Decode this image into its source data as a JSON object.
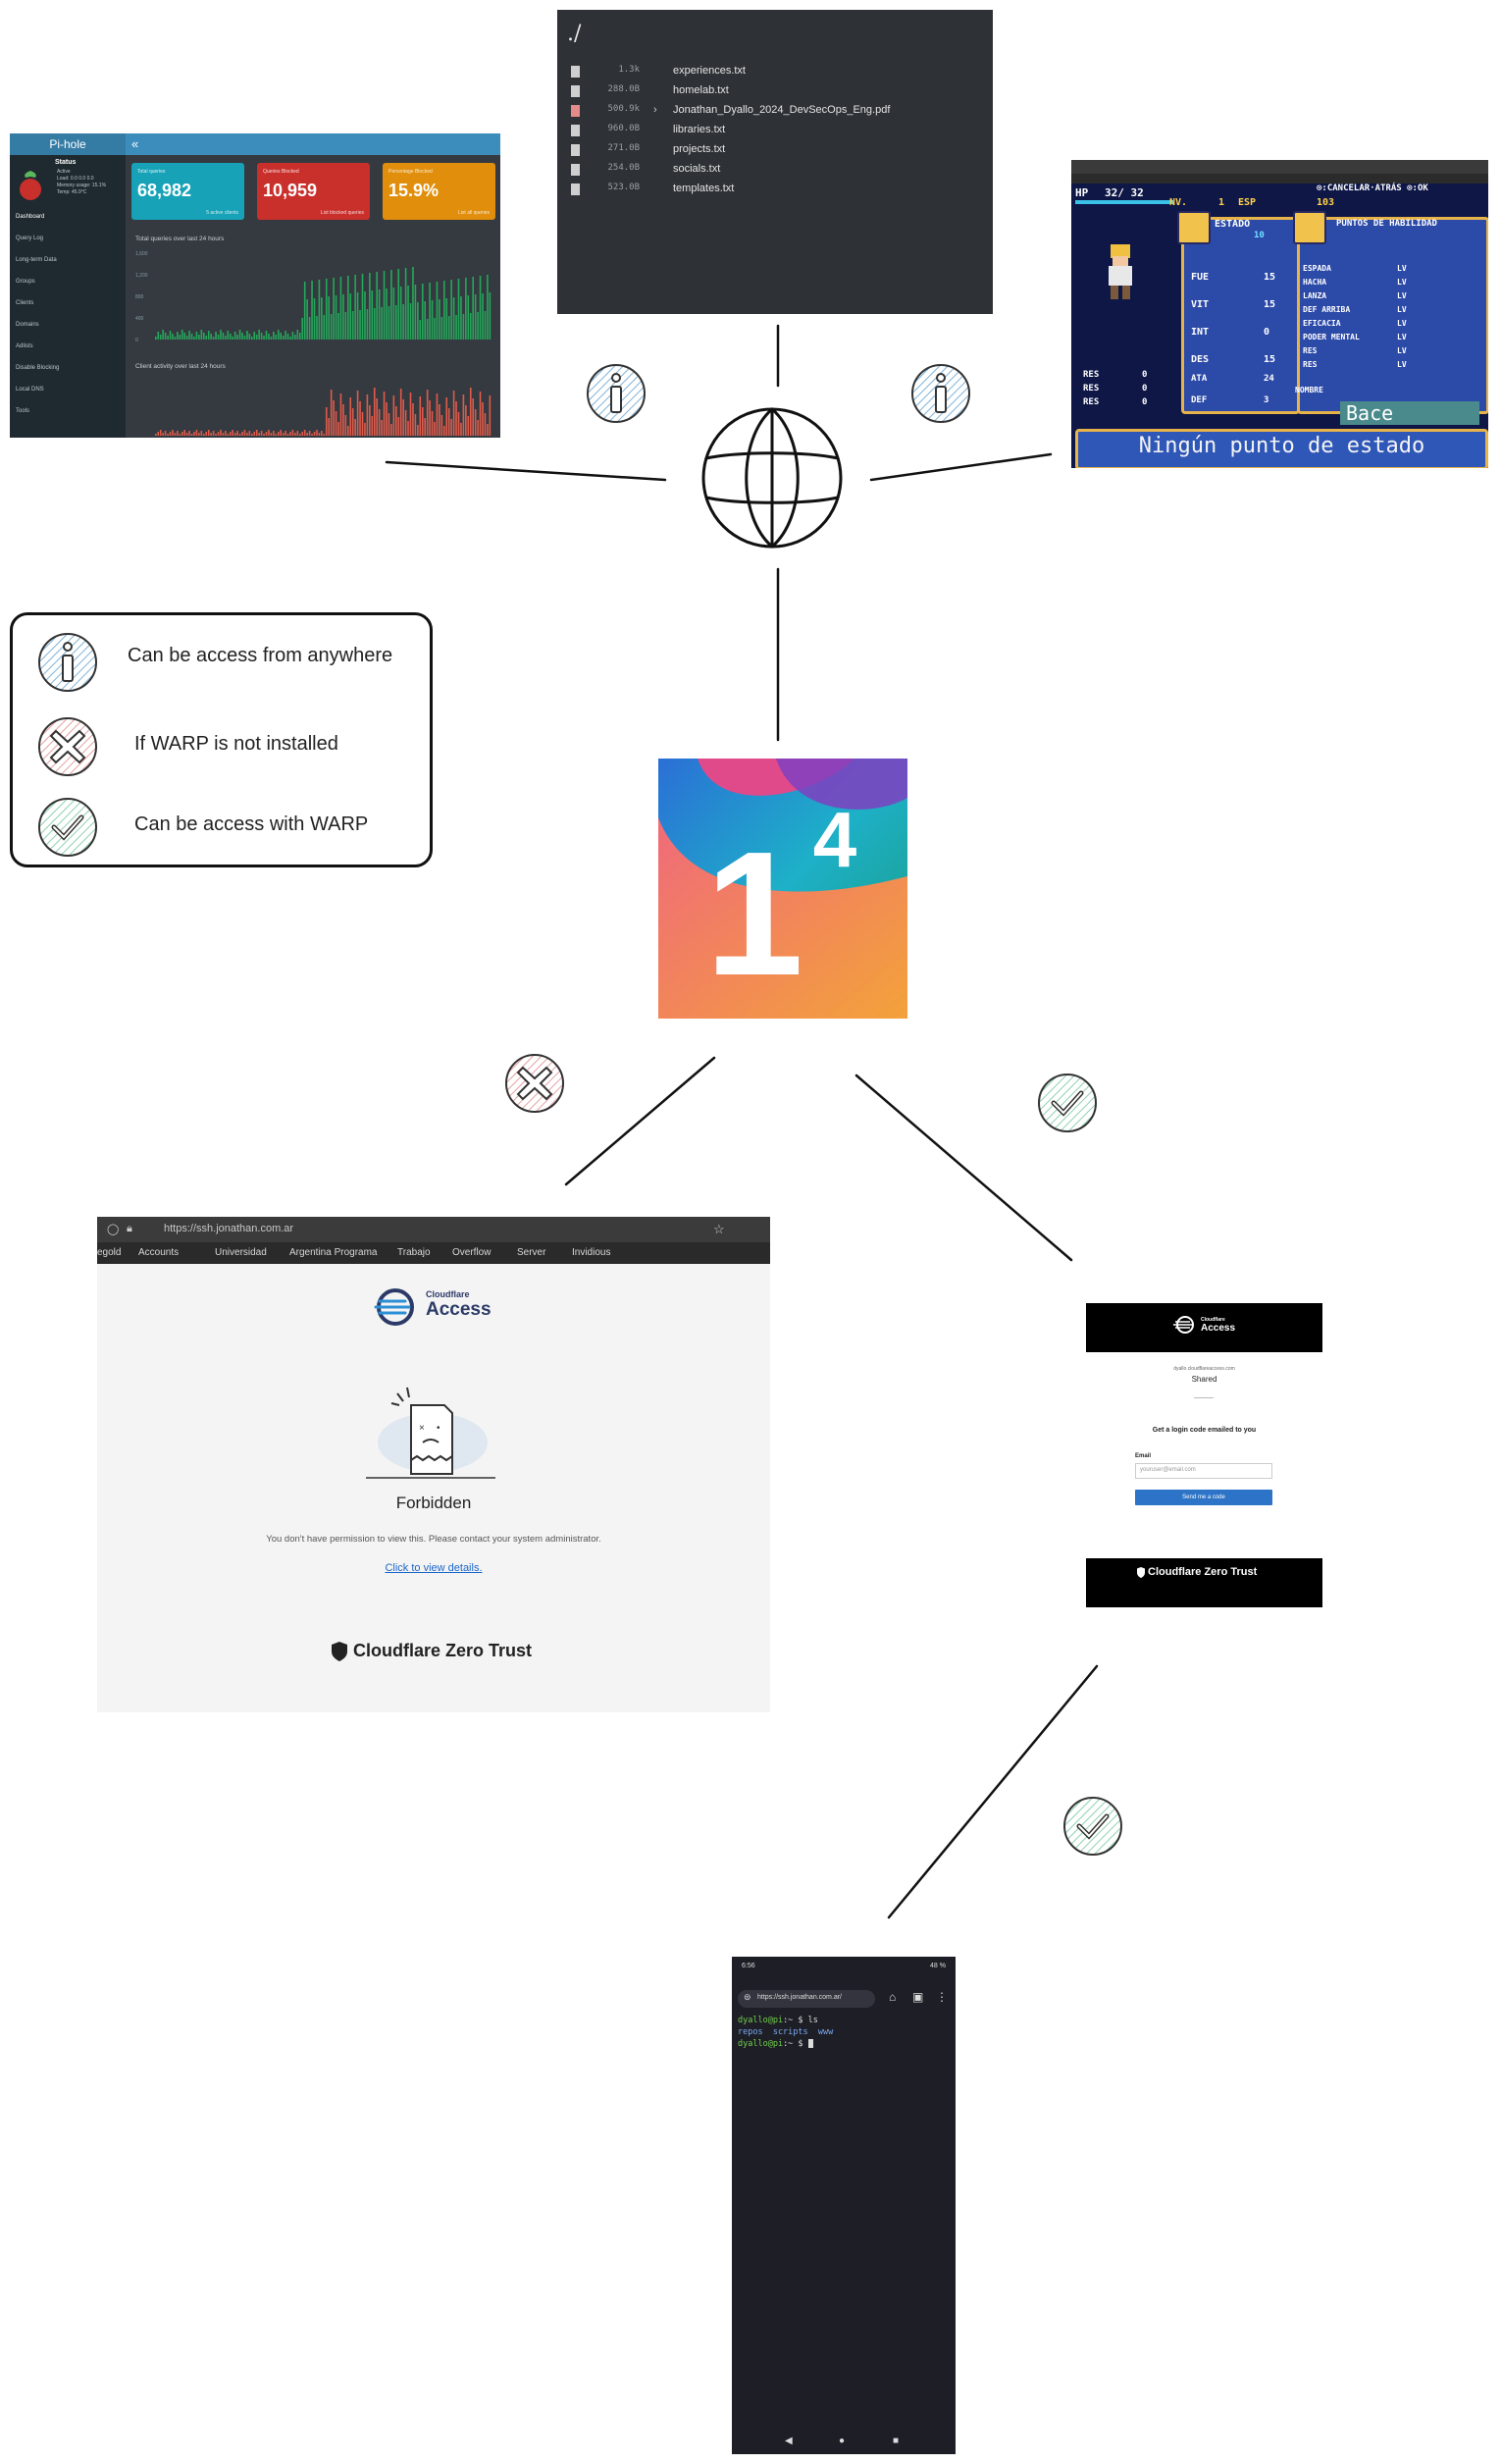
{
  "pihole": {
    "brand": "Pi-hole",
    "toggle": "«",
    "status": "Status",
    "status_lines": [
      "Active",
      "Load: 0.0 0.0 0.0",
      "Memory usage: 15.1%",
      "Temp: 45.9°C"
    ],
    "nav": [
      "Dashboard",
      "Query Log",
      "Long-term Data",
      "Groups",
      "Clients",
      "Domains",
      "Adlists",
      "Disable Blocking",
      "Local DNS",
      "Tools"
    ],
    "cards": [
      {
        "label": "Total queries",
        "value": "68,982",
        "foot": "5 active clients",
        "color": "#17a2b8"
      },
      {
        "label": "Queries Blocked",
        "value": "10,959",
        "foot": "List blocked queries",
        "color": "#dc3545"
      },
      {
        "label": "Percentage Blocked",
        "value": "15.9%",
        "foot": "List all queries",
        "color": "#f39c12"
      }
    ],
    "chart1_title": "Total queries over last 24 hours",
    "chart2_title": "Client activity over last 24 hours",
    "y_ticks": [
      "1,600",
      "1,200",
      "800",
      "400",
      "0"
    ]
  },
  "files": {
    "path": "./",
    "entries": [
      {
        "size": "1.3k",
        "name": "experiences.txt",
        "pdf": false,
        "chevron": ""
      },
      {
        "size": "288.0B",
        "name": "homelab.txt",
        "pdf": false,
        "chevron": ""
      },
      {
        "size": "500.9k",
        "name": "Jonathan_Dyallo_2024_DevSecOps_Eng.pdf",
        "pdf": true,
        "chevron": "›"
      },
      {
        "size": "960.0B",
        "name": "libraries.txt",
        "pdf": false,
        "chevron": ""
      },
      {
        "size": "271.0B",
        "name": "projects.txt",
        "pdf": false,
        "chevron": ""
      },
      {
        "size": "254.0B",
        "name": "socials.txt",
        "pdf": false,
        "chevron": ""
      },
      {
        "size": "523.0B",
        "name": "templates.txt",
        "pdf": false,
        "chevron": ""
      }
    ]
  },
  "rpg": {
    "hp_label": "HP",
    "hp": "32/ 32",
    "nv": "NV.",
    "nv_val": "1",
    "esp": "ESP",
    "esp_val": "103",
    "top_right": "⊙:CANCELAR·ATRÁS ⊙:OK",
    "estado": "ESTADO",
    "estado_val": "10",
    "puntos": "PUNTOS DE HABILIDAD",
    "stats": [
      {
        "label": "FUE",
        "value": "15"
      },
      {
        "label": "VIT",
        "value": "15"
      },
      {
        "label": "INT",
        "value": "0"
      },
      {
        "label": "DES",
        "value": "15"
      }
    ],
    "skills": [
      "ESPADA",
      "HACHA",
      "LANZA",
      "DEF ARRIBA",
      "EFICACIA",
      "PODER MENTAL",
      "RES",
      "RES"
    ],
    "lv": "LV",
    "res_rows": [
      {
        "label": "RES",
        "value": "0"
      },
      {
        "label": "RES",
        "value": "0"
      },
      {
        "label": "RES",
        "value": "0"
      }
    ],
    "ata_label": "ATA",
    "ata": "24",
    "def_label": "DEF",
    "def": "3",
    "nombre_label": "NOMBRE",
    "nombre": "Bace",
    "message": "Ningún punto de estado"
  },
  "legend": {
    "items": [
      {
        "label": "Can be access from anywhere"
      },
      {
        "label": "If WARP is not installed"
      },
      {
        "label": "Can be access with WARP"
      }
    ]
  },
  "center_logo": {
    "text": "1",
    "superscript": "4"
  },
  "forbidden": {
    "url": "https://ssh.jonathan.com.ar",
    "bookmarks": [
      "egold",
      "Accounts",
      "Universidad",
      "Argentina Programa",
      "Trabajo",
      "Overflow",
      "Server",
      "Invidious"
    ],
    "cf_small": "Cloudflare",
    "cf_big": "Access",
    "title": "Forbidden",
    "description": "You don't have permission to view this. Please contact your system administrator.",
    "link": "Click to view details.",
    "footer": "Cloudflare Zero Trust"
  },
  "login": {
    "cf_small": "Cloudflare",
    "cf_big": "Access",
    "subtitle": "dyallo.cloudflareaccess.com",
    "app": "Shared",
    "prompt": "Get a login code emailed to you",
    "email_label": "Email",
    "email_placeholder": "youruser@email.com",
    "button": "Send me a code",
    "footer": "Cloudflare Zero Trust"
  },
  "phone": {
    "time": "6:56",
    "battery": "48 %",
    "url": "https://ssh.jonathan.com.ar/",
    "prompt_user": "dyallo@pi",
    "prompt_rest": ":~ $ ",
    "cmd": "ls",
    "output": "repos  scripts  www",
    "prompt2_user": "dyallo@pi",
    "prompt2_rest": ":~ $ "
  }
}
